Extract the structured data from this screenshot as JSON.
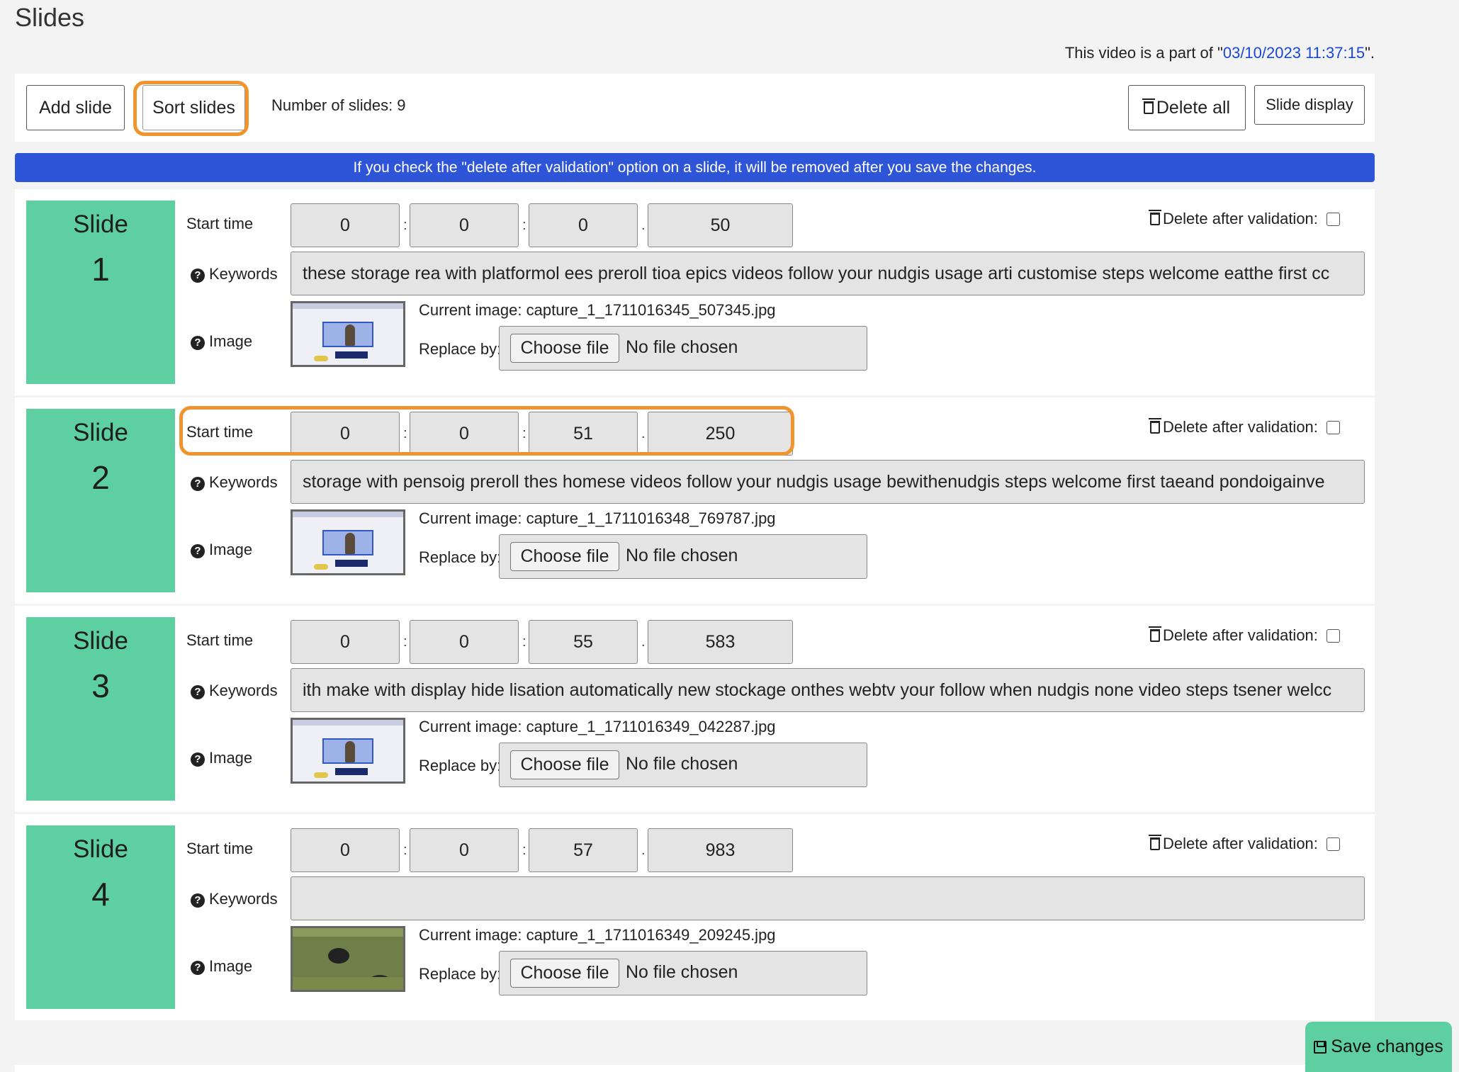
{
  "page": {
    "title": "Slides",
    "video_part_prefix": "This video is a part of \"",
    "video_part_link": "03/10/2023 11:37:15",
    "video_part_suffix": "\"."
  },
  "toolbar": {
    "add_slide": "Add slide",
    "sort_slides": "Sort slides",
    "count_text": "Number of slides: 9",
    "delete_all": "Delete all",
    "slide_display": "Slide display"
  },
  "banner": "If you check the \"delete after validation\" option on a slide, it will be removed after you save the changes.",
  "labels": {
    "slide": "Slide",
    "start_time": "Start time",
    "keywords": "Keywords",
    "image": "Image",
    "replace_by": "Replace by:",
    "delete_after": "Delete after validation:",
    "choose_file": "Choose file",
    "no_file": "No file chosen",
    "current_prefix": "Current image: "
  },
  "slides": [
    {
      "num": "1",
      "h": "0",
      "m": "0",
      "s": "0",
      "ms": "50",
      "keywords": "these storage rea with platformol ees preroll tioa epics videos follow your nudgis usage arti customise steps welcome eatthe first cc",
      "image": "Current image: capture_1_1711016345_507345.jpg",
      "thumb": "screen"
    },
    {
      "num": "2",
      "h": "0",
      "m": "0",
      "s": "51",
      "ms": "250",
      "keywords": "storage with pensoig preroll thes homese videos follow your nudgis usage bewithenudgis steps welcome first taeand pondoigainve",
      "image": "Current image: capture_1_1711016348_769787.jpg",
      "thumb": "screen"
    },
    {
      "num": "3",
      "h": "0",
      "m": "0",
      "s": "55",
      "ms": "583",
      "keywords": "ith make with display hide lisation automatically new stockage onthes webtv your follow when nudgis none video steps tsener welcc",
      "image": "Current image: capture_1_1711016349_042287.jpg",
      "thumb": "screen"
    },
    {
      "num": "4",
      "h": "0",
      "m": "0",
      "s": "57",
      "ms": "983",
      "keywords": "",
      "image": "Current image: capture_1_1711016349_209245.jpg",
      "thumb": "nature"
    }
  ],
  "save_changes": "Save changes",
  "colors": {
    "accent_green": "#5ecfa0",
    "banner_blue": "#2e55d8",
    "highlight_orange": "#f0952d",
    "link_blue": "#1a47d6"
  }
}
